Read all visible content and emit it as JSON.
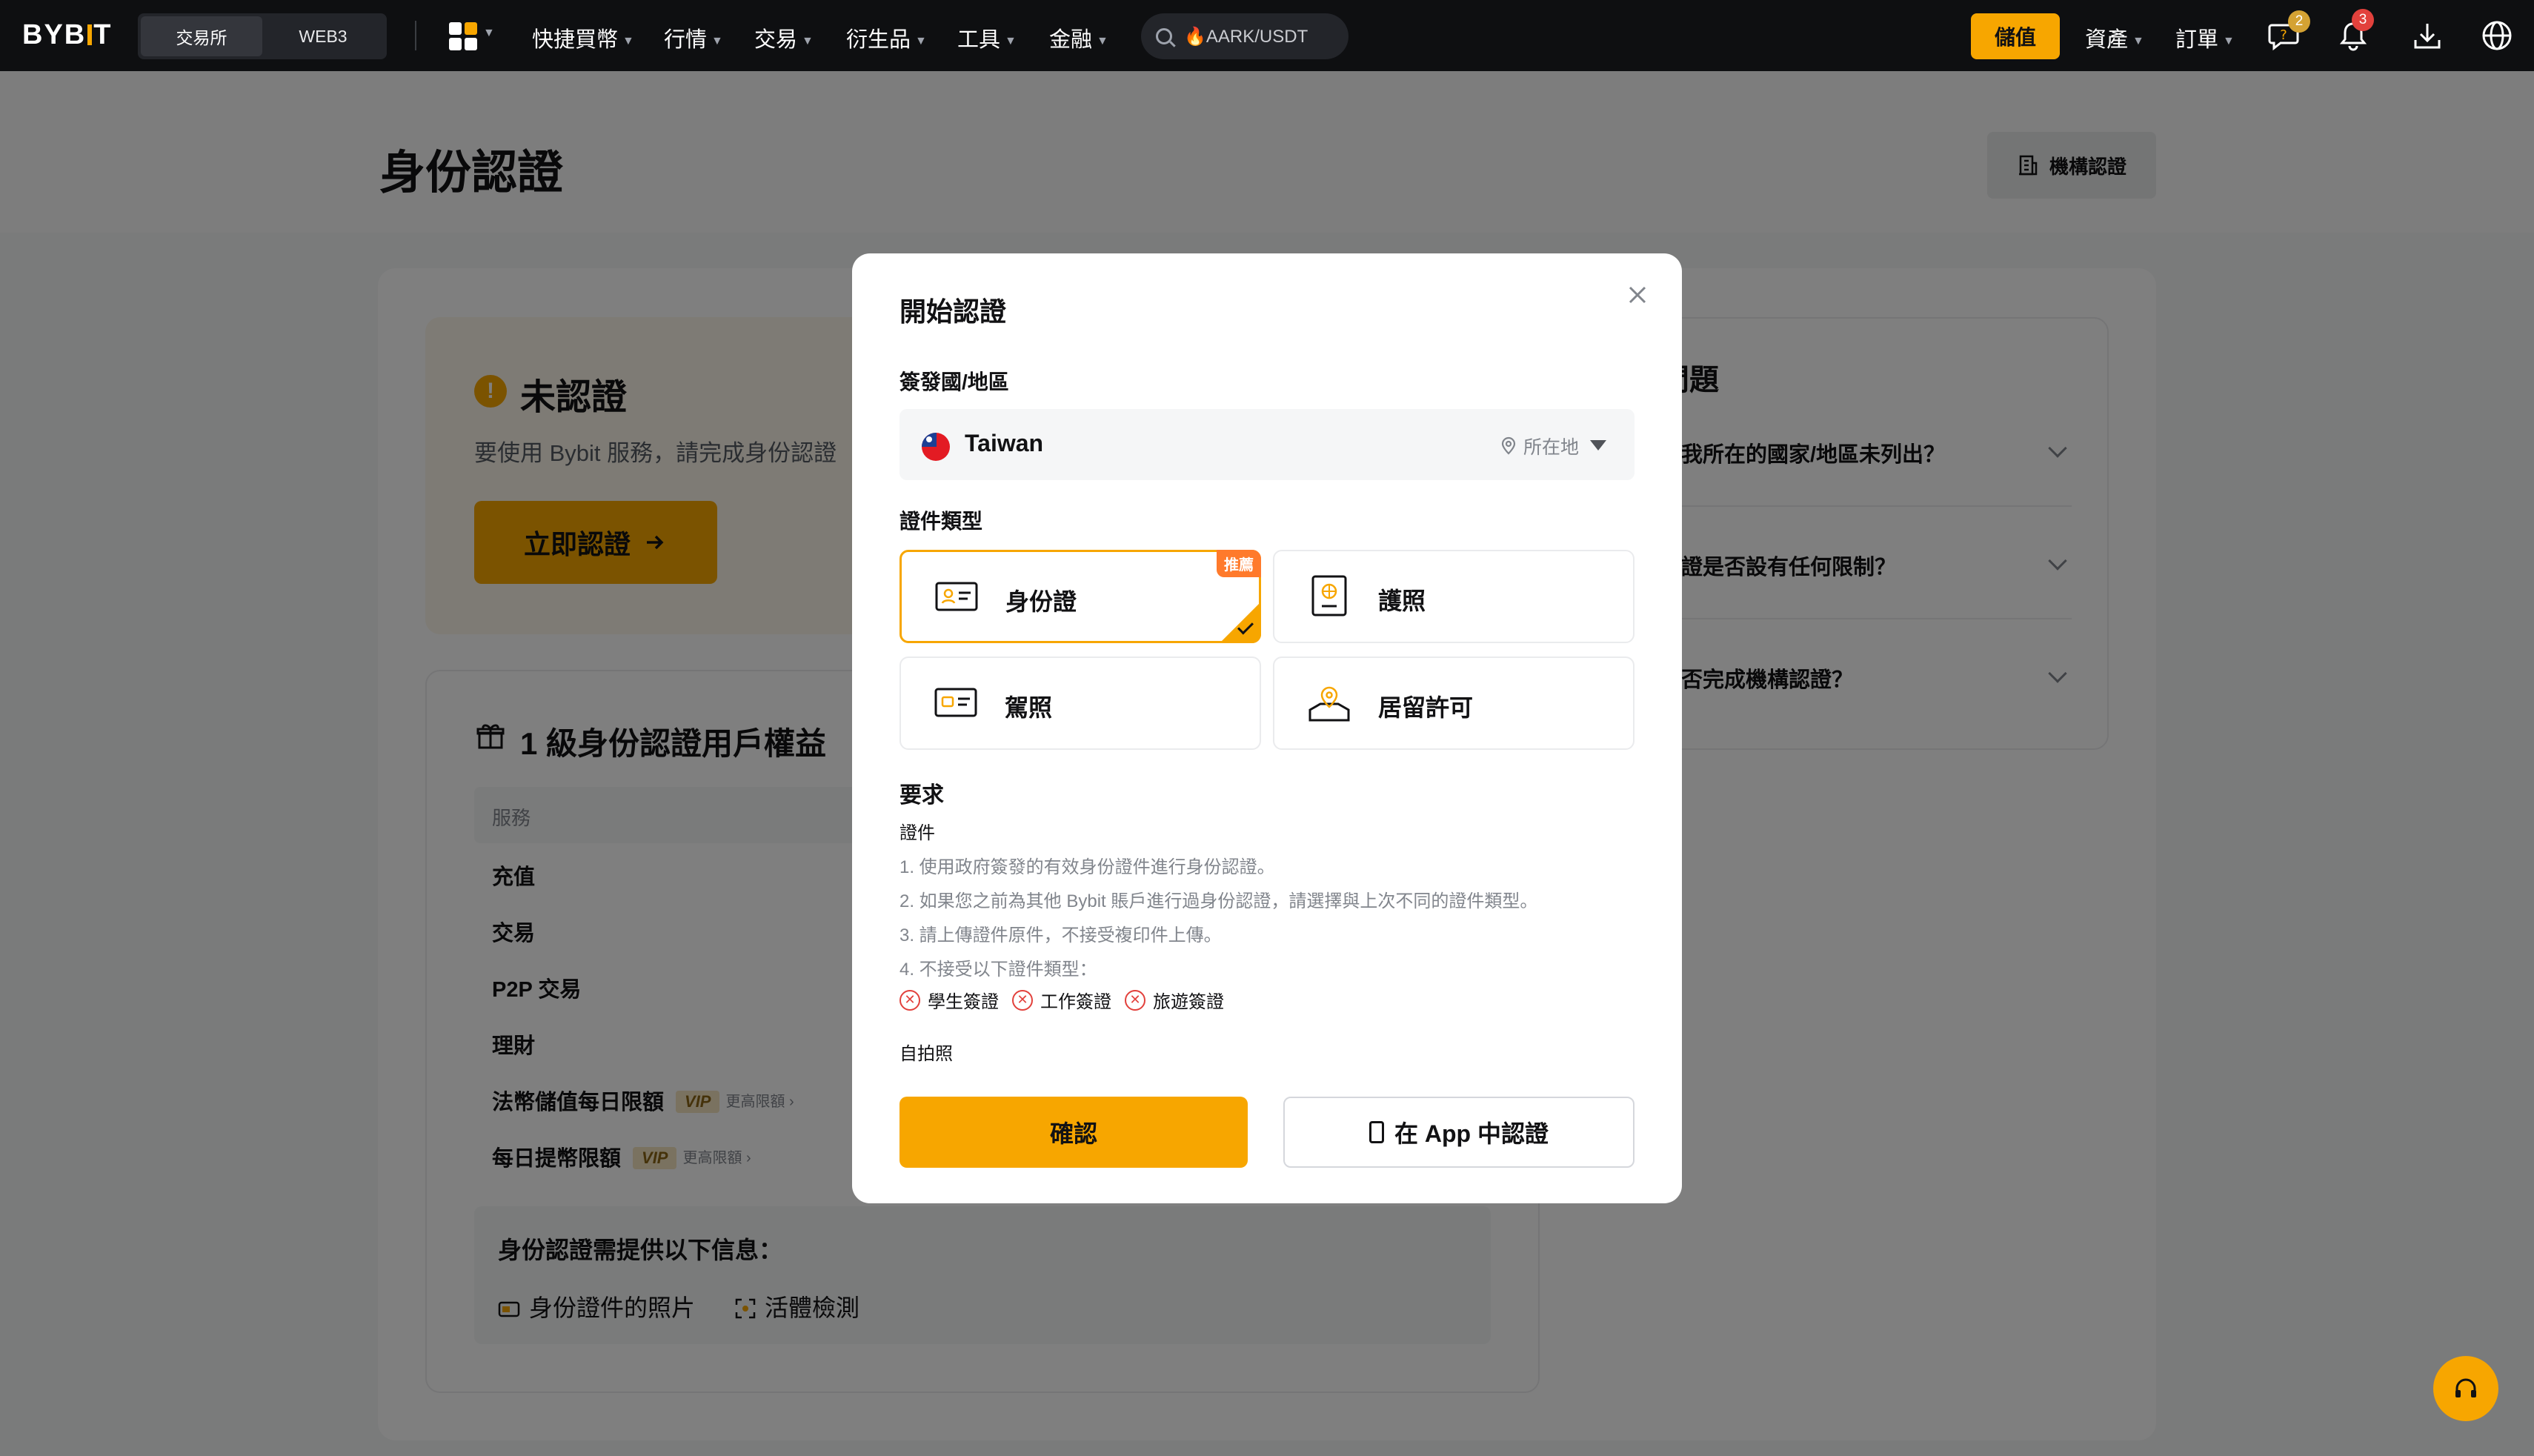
{
  "nav": {
    "logo": "BYBIT",
    "segments": [
      "交易所",
      "WEB3"
    ],
    "items": [
      "快捷買幣",
      "行情",
      "交易",
      "衍生品",
      "工具",
      "金融"
    ],
    "search_text": "🔥AARK/USDT",
    "deposit": "儲值",
    "assets": "資產",
    "orders": "訂單",
    "chat_badge": "2",
    "notif_badge": "3"
  },
  "page": {
    "title": "身份認證",
    "institution_btn": "機構認證"
  },
  "status": {
    "title": "未認證",
    "icon": "!",
    "subtitle": "要使用 Bybit 服務，請完成身份認證",
    "verify_btn": "立即認證"
  },
  "benefits": {
    "title": "1 級身份認證用戶權益",
    "col_header": "服務",
    "rows": [
      "充值",
      "交易",
      "P2P 交易",
      "理財",
      "法幣儲值每日限額",
      "每日提幣限額"
    ],
    "vip": "VIP",
    "more": "更高限額",
    "info_title": "身份認證需提供以下信息：",
    "info_items": [
      "身份證件的照片",
      "活體檢測"
    ]
  },
  "faq": {
    "title": "問題",
    "questions": [
      "若我所在的國家/地區未列出？",
      "認證是否設有任何限制？",
      "是否完成機構認證？"
    ]
  },
  "modal": {
    "title": "開始認證",
    "country_label": "簽發國/地區",
    "country": "Taiwan",
    "location_tag": "所在地",
    "doc_type_label": "證件類型",
    "doc_types": [
      "身份證",
      "護照",
      "駕照",
      "居留許可"
    ],
    "recommend_tag": "推薦",
    "requirements_title": "要求",
    "doc_section": "證件",
    "req_lines": [
      "1. 使用政府簽發的有效身份證件進行身份認證。",
      "2. 如果您之前為其他 Bybit 賬戶進行過身份認證，請選擇與上次不同的證件類型。",
      "3. 請上傳證件原件，不接受複印件上傳。",
      "4. 不接受以下證件類型："
    ],
    "rejected": [
      "學生簽證",
      "工作簽證",
      "旅遊簽證"
    ],
    "selfie_section": "自拍照",
    "confirm_btn": "確認",
    "app_btn": "在 App 中認證"
  },
  "colors": {
    "brand": "#f7a600",
    "reject": "#e2413c",
    "recommend": "#ff7a2b"
  }
}
